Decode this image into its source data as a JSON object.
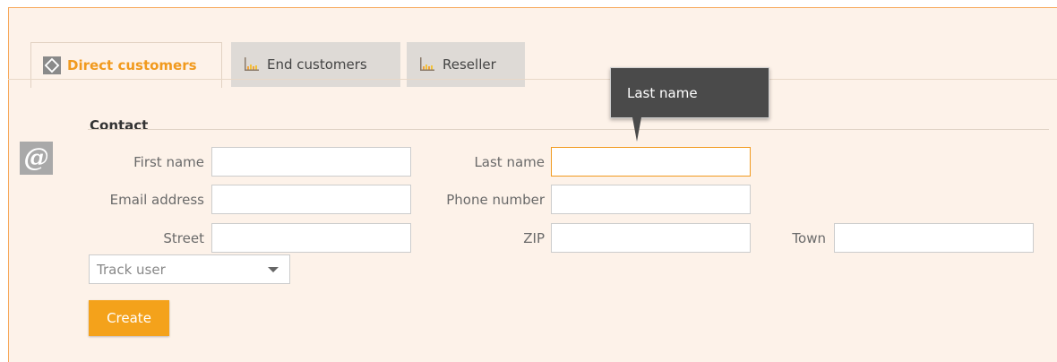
{
  "tabs": [
    {
      "label": "Direct customers",
      "active": true,
      "icon": "diamond-icon"
    },
    {
      "label": "End customers",
      "active": false,
      "icon": "chart-icon"
    },
    {
      "label": "Reseller",
      "active": false,
      "icon": "chart-icon"
    }
  ],
  "section": {
    "title": "Contact",
    "icon": "at-icon",
    "icon_glyph": "@"
  },
  "form": {
    "first_name": {
      "label": "First name",
      "value": ""
    },
    "last_name": {
      "label": "Last name",
      "value": ""
    },
    "email": {
      "label": "Email address",
      "value": ""
    },
    "phone": {
      "label": "Phone number",
      "value": ""
    },
    "street": {
      "label": "Street",
      "value": ""
    },
    "zip": {
      "label": "ZIP",
      "value": ""
    },
    "town": {
      "label": "Town",
      "value": ""
    },
    "track_user": {
      "selected": "Track user"
    },
    "create_label": "Create"
  },
  "tooltip": {
    "text": "Last name"
  },
  "colors": {
    "accent": "#f19a1e",
    "button": "#f4a21b",
    "panel_bg": "#fdf2e9",
    "tooltip_bg": "#4a4a4a"
  }
}
